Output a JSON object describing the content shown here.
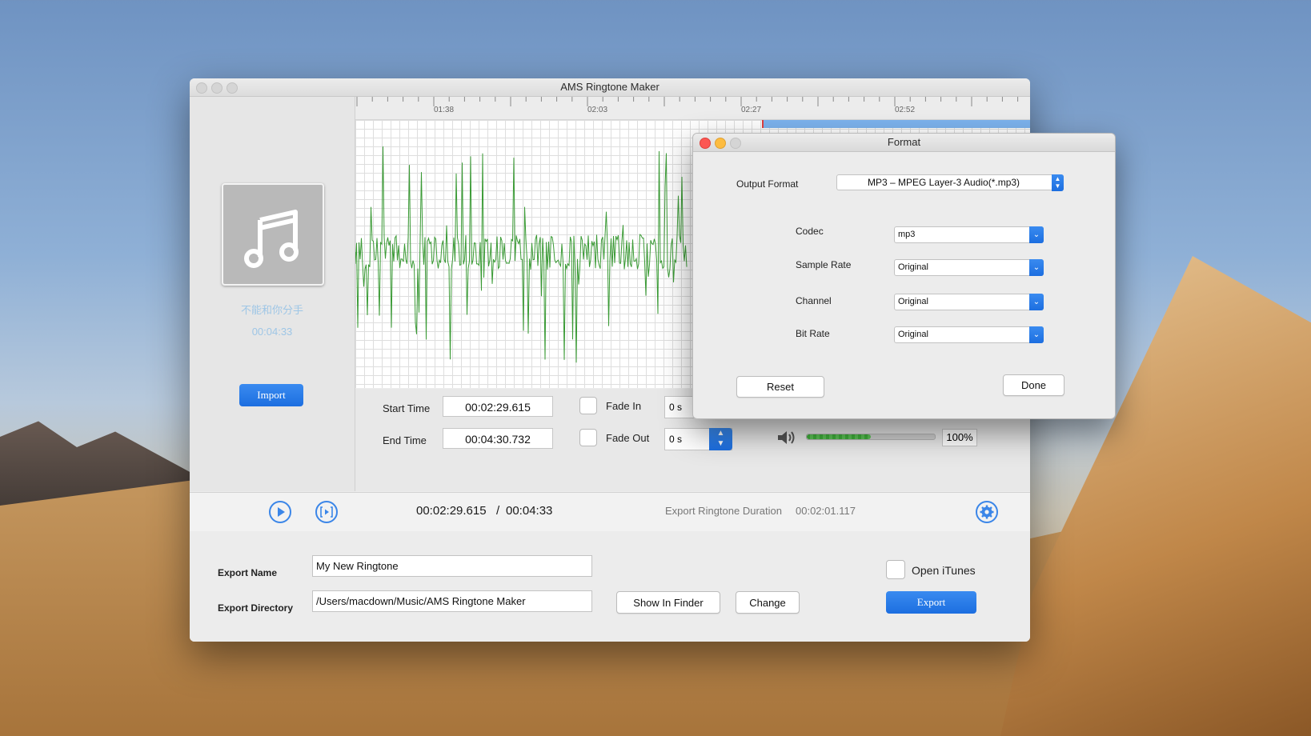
{
  "window": {
    "title": "AMS Ringtone Maker"
  },
  "song": {
    "title": "不能和你分手",
    "duration": "00:04:33"
  },
  "left_panel": {
    "import_label": "Import"
  },
  "ruler": {
    "labels": [
      "01:38",
      "02:03",
      "02:27",
      "02:52"
    ]
  },
  "controls": {
    "start_time_label": "Start Time",
    "start_time": "00:02:29.615",
    "end_time_label": "End Time",
    "end_time": "00:04:30.732",
    "fade_in_label": "Fade In",
    "fade_in_value": "0 s",
    "fade_out_label": "Fade Out",
    "fade_out_value": "0 s",
    "volume_value": "100%",
    "volume_level": 0.5,
    "zoom_level": 0.7
  },
  "playbar": {
    "current_time": "00:02:29.615",
    "separator": "/",
    "total_time": "00:04:33",
    "export_duration_label": "Export Ringtone Duration",
    "export_duration": "00:02:01.117"
  },
  "export": {
    "name_label": "Export Name",
    "name_value": "My New Ringtone",
    "directory_label": "Export Directory",
    "directory_value": "/Users/macdown/Music/AMS Ringtone Maker",
    "show_in_finder_label": "Show In Finder",
    "change_label": "Change",
    "open_itunes_label": "Open iTunes",
    "export_label": "Export"
  },
  "format_dialog": {
    "title": "Format",
    "output_format_label": "Output Format",
    "output_format_value": "MP3 – MPEG Layer-3 Audio(*.mp3)",
    "codec_label": "Codec",
    "codec_value": "mp3",
    "sample_rate_label": "Sample Rate",
    "sample_rate_value": "Original",
    "channel_label": "Channel",
    "channel_value": "Original",
    "bit_rate_label": "Bit Rate",
    "bit_rate_value": "Original",
    "reset_label": "Reset",
    "done_label": "Done"
  },
  "colors": {
    "accent": "#1c6ee0",
    "waveform": "#3a9a35",
    "song_text": "#9ec6e6"
  }
}
